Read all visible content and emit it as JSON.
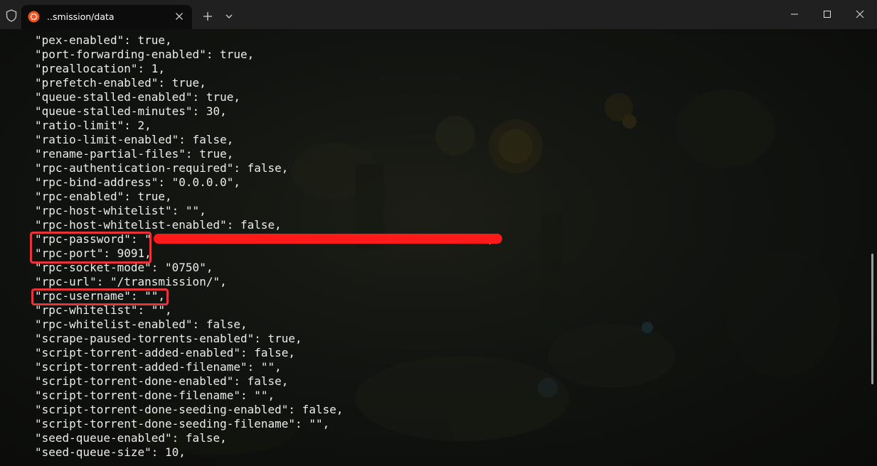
{
  "window": {
    "tab_title": "..smission/data",
    "icons": {
      "shield": "shield-icon",
      "tab": "ubuntu-icon",
      "tab_close": "close-icon",
      "new_tab": "plus-icon",
      "dropdown": "chevron-down-icon",
      "minimize": "minimize-icon",
      "maximize": "maximize-icon",
      "close": "close-icon"
    }
  },
  "terminal": {
    "lines": [
      "\"pex-enabled\": true,",
      "\"port-forwarding-enabled\": true,",
      "\"preallocation\": 1,",
      "\"prefetch-enabled\": true,",
      "\"queue-stalled-enabled\": true,",
      "\"queue-stalled-minutes\": 30,",
      "\"ratio-limit\": 2,",
      "\"ratio-limit-enabled\": false,",
      "\"rename-partial-files\": true,",
      "\"rpc-authentication-required\": false,",
      "\"rpc-bind-address\": \"0.0.0.0\",",
      "\"rpc-enabled\": true,",
      "\"rpc-host-whitelist\": \"\",",
      "\"rpc-host-whitelist-enabled\": false,",
      "\"rpc-password\": \"                                                \",",
      "\"rpc-port\": 9091,",
      "\"rpc-socket-mode\": \"0750\",",
      "\"rpc-url\": \"/transmission/\",",
      "\"rpc-username\": \"\",",
      "\"rpc-whitelist\": \"\",",
      "\"rpc-whitelist-enabled\": false,",
      "\"scrape-paused-torrents-enabled\": true,",
      "\"script-torrent-added-enabled\": false,",
      "\"script-torrent-added-filename\": \"\",",
      "\"script-torrent-done-enabled\": false,",
      "\"script-torrent-done-filename\": \"\",",
      "\"script-torrent-done-seeding-enabled\": false,",
      "\"script-torrent-done-seeding-filename\": \"\",",
      "\"seed-queue-enabled\": false,",
      "\"seed-queue-size\": 10,"
    ]
  },
  "annotations": {
    "box_color": "#e8333a",
    "redaction_color": "#ff1a1a"
  }
}
